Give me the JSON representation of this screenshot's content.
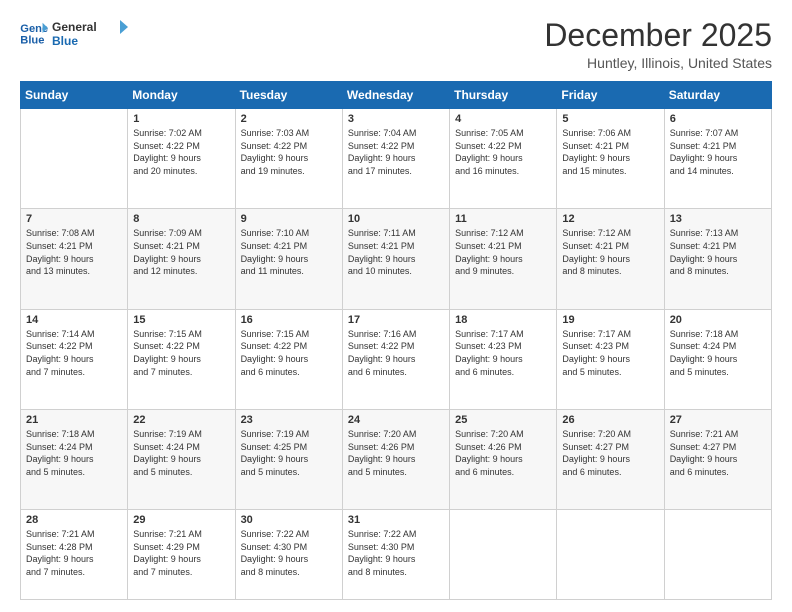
{
  "header": {
    "logo_line1": "General",
    "logo_line2": "Blue",
    "month": "December 2025",
    "location": "Huntley, Illinois, United States"
  },
  "days_of_week": [
    "Sunday",
    "Monday",
    "Tuesday",
    "Wednesday",
    "Thursday",
    "Friday",
    "Saturday"
  ],
  "weeks": [
    [
      {
        "num": "",
        "info": ""
      },
      {
        "num": "1",
        "info": "Sunrise: 7:02 AM\nSunset: 4:22 PM\nDaylight: 9 hours\nand 20 minutes."
      },
      {
        "num": "2",
        "info": "Sunrise: 7:03 AM\nSunset: 4:22 PM\nDaylight: 9 hours\nand 19 minutes."
      },
      {
        "num": "3",
        "info": "Sunrise: 7:04 AM\nSunset: 4:22 PM\nDaylight: 9 hours\nand 17 minutes."
      },
      {
        "num": "4",
        "info": "Sunrise: 7:05 AM\nSunset: 4:22 PM\nDaylight: 9 hours\nand 16 minutes."
      },
      {
        "num": "5",
        "info": "Sunrise: 7:06 AM\nSunset: 4:21 PM\nDaylight: 9 hours\nand 15 minutes."
      },
      {
        "num": "6",
        "info": "Sunrise: 7:07 AM\nSunset: 4:21 PM\nDaylight: 9 hours\nand 14 minutes."
      }
    ],
    [
      {
        "num": "7",
        "info": "Sunrise: 7:08 AM\nSunset: 4:21 PM\nDaylight: 9 hours\nand 13 minutes."
      },
      {
        "num": "8",
        "info": "Sunrise: 7:09 AM\nSunset: 4:21 PM\nDaylight: 9 hours\nand 12 minutes."
      },
      {
        "num": "9",
        "info": "Sunrise: 7:10 AM\nSunset: 4:21 PM\nDaylight: 9 hours\nand 11 minutes."
      },
      {
        "num": "10",
        "info": "Sunrise: 7:11 AM\nSunset: 4:21 PM\nDaylight: 9 hours\nand 10 minutes."
      },
      {
        "num": "11",
        "info": "Sunrise: 7:12 AM\nSunset: 4:21 PM\nDaylight: 9 hours\nand 9 minutes."
      },
      {
        "num": "12",
        "info": "Sunrise: 7:12 AM\nSunset: 4:21 PM\nDaylight: 9 hours\nand 8 minutes."
      },
      {
        "num": "13",
        "info": "Sunrise: 7:13 AM\nSunset: 4:21 PM\nDaylight: 9 hours\nand 8 minutes."
      }
    ],
    [
      {
        "num": "14",
        "info": "Sunrise: 7:14 AM\nSunset: 4:22 PM\nDaylight: 9 hours\nand 7 minutes."
      },
      {
        "num": "15",
        "info": "Sunrise: 7:15 AM\nSunset: 4:22 PM\nDaylight: 9 hours\nand 7 minutes."
      },
      {
        "num": "16",
        "info": "Sunrise: 7:15 AM\nSunset: 4:22 PM\nDaylight: 9 hours\nand 6 minutes."
      },
      {
        "num": "17",
        "info": "Sunrise: 7:16 AM\nSunset: 4:22 PM\nDaylight: 9 hours\nand 6 minutes."
      },
      {
        "num": "18",
        "info": "Sunrise: 7:17 AM\nSunset: 4:23 PM\nDaylight: 9 hours\nand 6 minutes."
      },
      {
        "num": "19",
        "info": "Sunrise: 7:17 AM\nSunset: 4:23 PM\nDaylight: 9 hours\nand 5 minutes."
      },
      {
        "num": "20",
        "info": "Sunrise: 7:18 AM\nSunset: 4:24 PM\nDaylight: 9 hours\nand 5 minutes."
      }
    ],
    [
      {
        "num": "21",
        "info": "Sunrise: 7:18 AM\nSunset: 4:24 PM\nDaylight: 9 hours\nand 5 minutes."
      },
      {
        "num": "22",
        "info": "Sunrise: 7:19 AM\nSunset: 4:24 PM\nDaylight: 9 hours\nand 5 minutes."
      },
      {
        "num": "23",
        "info": "Sunrise: 7:19 AM\nSunset: 4:25 PM\nDaylight: 9 hours\nand 5 minutes."
      },
      {
        "num": "24",
        "info": "Sunrise: 7:20 AM\nSunset: 4:26 PM\nDaylight: 9 hours\nand 5 minutes."
      },
      {
        "num": "25",
        "info": "Sunrise: 7:20 AM\nSunset: 4:26 PM\nDaylight: 9 hours\nand 6 minutes."
      },
      {
        "num": "26",
        "info": "Sunrise: 7:20 AM\nSunset: 4:27 PM\nDaylight: 9 hours\nand 6 minutes."
      },
      {
        "num": "27",
        "info": "Sunrise: 7:21 AM\nSunset: 4:27 PM\nDaylight: 9 hours\nand 6 minutes."
      }
    ],
    [
      {
        "num": "28",
        "info": "Sunrise: 7:21 AM\nSunset: 4:28 PM\nDaylight: 9 hours\nand 7 minutes."
      },
      {
        "num": "29",
        "info": "Sunrise: 7:21 AM\nSunset: 4:29 PM\nDaylight: 9 hours\nand 7 minutes."
      },
      {
        "num": "30",
        "info": "Sunrise: 7:22 AM\nSunset: 4:30 PM\nDaylight: 9 hours\nand 8 minutes."
      },
      {
        "num": "31",
        "info": "Sunrise: 7:22 AM\nSunset: 4:30 PM\nDaylight: 9 hours\nand 8 minutes."
      },
      {
        "num": "",
        "info": ""
      },
      {
        "num": "",
        "info": ""
      },
      {
        "num": "",
        "info": ""
      }
    ]
  ]
}
